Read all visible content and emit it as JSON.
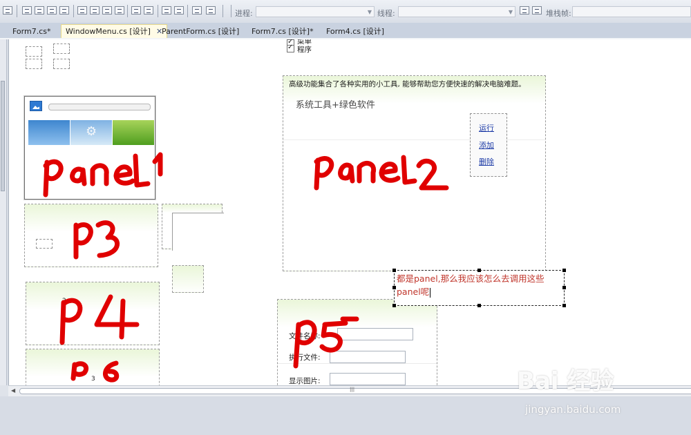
{
  "toolbar": {
    "process_label": "进程:",
    "thread_label": "线程:",
    "stack_label": "堆栈帧:"
  },
  "tabs": [
    {
      "label": "Form7.cs*",
      "active": false
    },
    {
      "label": "WindowMenu.cs [设计]",
      "active": true
    },
    {
      "label": "ParentForm.cs [设计]",
      "active": false
    },
    {
      "label": "Form7.cs [设计]*",
      "active": false
    },
    {
      "label": "Form4.cs [设计]",
      "active": false
    }
  ],
  "checklist": {
    "items": [
      {
        "label": "菜单",
        "checked": true
      },
      {
        "label": "程序",
        "checked": true
      }
    ]
  },
  "panel2": {
    "description": "高级功能集合了各种实用的小工具, 能够帮助您方便快速的解决电脑难题。",
    "title": "系统工具+绿色软件",
    "links": [
      "运行",
      "添加",
      "删除"
    ]
  },
  "panel4": {
    "small_text": "2"
  },
  "panel6": {
    "small_text": "3"
  },
  "panel5": {
    "fields": [
      {
        "label": "文件名称:"
      },
      {
        "label": "执行文件:"
      },
      {
        "label": "显示图片:"
      }
    ]
  },
  "selected_label": {
    "text": "都是panel,那么我应该怎么去调用这些panel呢"
  },
  "annotations": {
    "handwriting": [
      "panel1",
      "panel2",
      "P3",
      "P4",
      "P5",
      "P6"
    ],
    "color": "#e00000"
  },
  "watermark": {
    "logo": "Bai 经验",
    "url": "jingyan.baidu.com"
  },
  "colors": {
    "tab_active_bg": "#fffbe6",
    "panel_gradient": "#eaf6d9",
    "label_text": "#c0352b",
    "link": "#1c3aa6"
  }
}
